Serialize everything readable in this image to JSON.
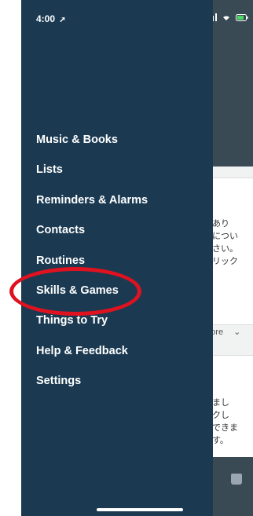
{
  "status_bar": {
    "time": "4:00",
    "location_icon": "location-arrow-icon",
    "signal_icon": "signal-icon",
    "wifi_icon": "wifi-icon",
    "battery_icon": "battery-icon"
  },
  "drawer": {
    "items": [
      {
        "label": "Music & Books"
      },
      {
        "label": "Lists"
      },
      {
        "label": "Reminders & Alarms"
      },
      {
        "label": "Contacts"
      },
      {
        "label": "Routines"
      },
      {
        "label": "Skills & Games"
      },
      {
        "label": "Things to Try"
      },
      {
        "label": "Help & Feedback"
      },
      {
        "label": "Settings"
      }
    ]
  },
  "background": {
    "card1_lines": [
      "きあり",
      "能につい",
      "ださい。",
      "クリック"
    ],
    "more_label": "More",
    "card2_lines": [
      "りまし",
      "ックし",
      "ができま",
      "ます。"
    ]
  },
  "colors": {
    "drawer_bg": "#1b3a52",
    "annotation": "#e0121f"
  }
}
